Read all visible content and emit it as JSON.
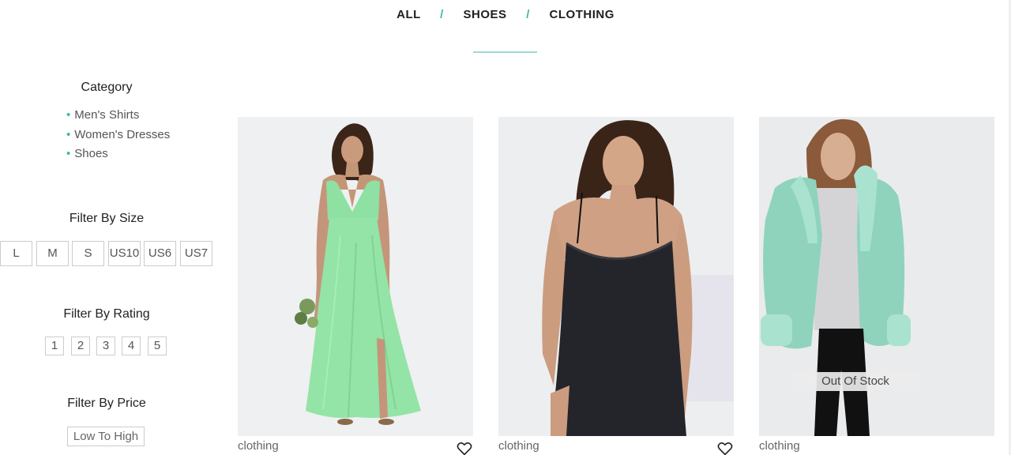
{
  "nav": {
    "items": [
      "ALL",
      "SHOES",
      "CLOTHING"
    ],
    "separator": "/"
  },
  "sidebar": {
    "category_title": "Category",
    "categories": [
      "Men's Shirts",
      "Women's Dresses",
      "Shoes"
    ],
    "size_title": "Filter By Size",
    "sizes": [
      "L",
      "M",
      "S",
      "US10",
      "US6",
      "US7"
    ],
    "rating_title": "Filter By Rating",
    "ratings": [
      "1",
      "2",
      "3",
      "4",
      "5"
    ],
    "price_title": "Filter By Price",
    "price_sort": "Low To High"
  },
  "products": [
    {
      "category": "clothing",
      "image": "mint-green-maxi-dress",
      "out_of_stock": ""
    },
    {
      "category": "clothing",
      "image": "black-slip-dress",
      "out_of_stock": ""
    },
    {
      "category": "clothing",
      "image": "mint-shearling-jacket",
      "out_of_stock": "Out Of Stock"
    }
  ],
  "colors": {
    "accent": "#3fb7ad",
    "border": "#cccccc"
  }
}
